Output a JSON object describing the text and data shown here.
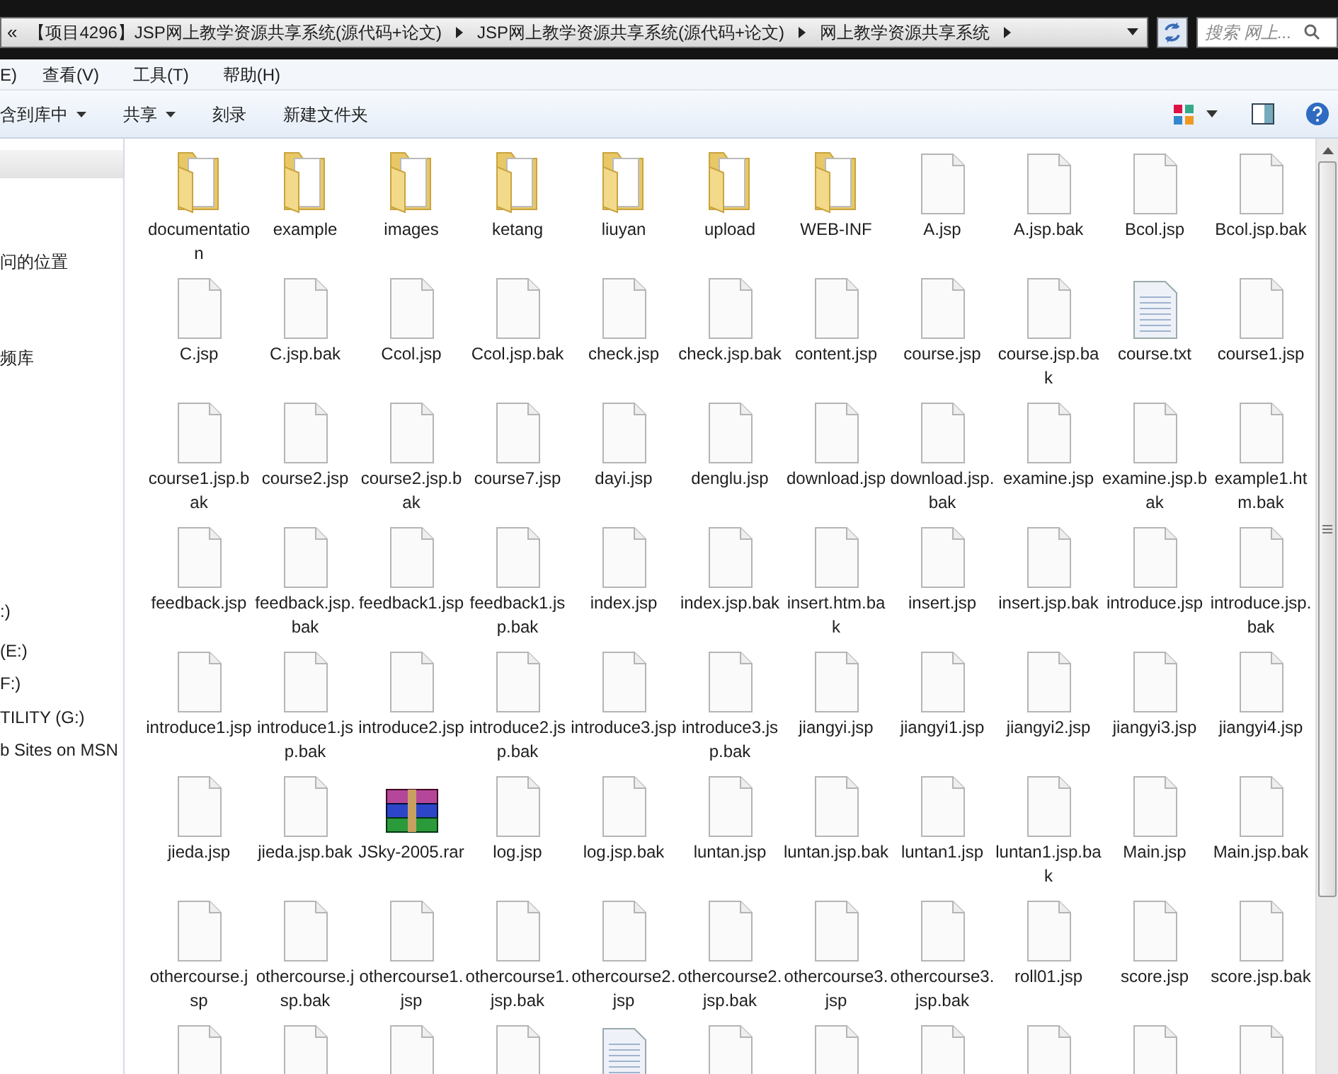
{
  "address_bar": {
    "overflow": "«",
    "crumbs": [
      "【项目4296】JSP网上教学资源共享系统(源代码+论文)",
      "JSP网上教学资源共享系统(源代码+论文)",
      "网上教学资源共享系统"
    ]
  },
  "search": {
    "placeholder": "搜索 网上..."
  },
  "menu": [
    "E)",
    "查看(V)",
    "工具(T)",
    "帮助(H)"
  ],
  "toolbar": [
    {
      "label": "含到库中",
      "dropdown": true
    },
    {
      "label": "共享",
      "dropdown": true
    },
    {
      "label": "刻录",
      "dropdown": false
    },
    {
      "label": "新建文件夹",
      "dropdown": false
    }
  ],
  "sidebar": {
    "items": [
      "问的位置",
      "频库",
      ":)",
      "(E:)",
      "F:)",
      "TILITY (G:)",
      "b Sites on MSN"
    ]
  },
  "files": [
    {
      "name": "documentation",
      "kind": "folder"
    },
    {
      "name": "example",
      "kind": "folder"
    },
    {
      "name": "images",
      "kind": "folder"
    },
    {
      "name": "ketang",
      "kind": "folder"
    },
    {
      "name": "liuyan",
      "kind": "folder"
    },
    {
      "name": "upload",
      "kind": "folder"
    },
    {
      "name": "WEB-INF",
      "kind": "folder"
    },
    {
      "name": "A.jsp",
      "kind": "file"
    },
    {
      "name": "A.jsp.bak",
      "kind": "file"
    },
    {
      "name": "Bcol.jsp",
      "kind": "file"
    },
    {
      "name": "Bcol.jsp.bak",
      "kind": "file"
    },
    {
      "name": "C.jsp",
      "kind": "file"
    },
    {
      "name": "C.jsp.bak",
      "kind": "file"
    },
    {
      "name": "Ccol.jsp",
      "kind": "file"
    },
    {
      "name": "Ccol.jsp.bak",
      "kind": "file"
    },
    {
      "name": "check.jsp",
      "kind": "file"
    },
    {
      "name": "check.jsp.bak",
      "kind": "file"
    },
    {
      "name": "content.jsp",
      "kind": "file"
    },
    {
      "name": "course.jsp",
      "kind": "file"
    },
    {
      "name": "course.jsp.bak",
      "kind": "file"
    },
    {
      "name": "course.txt",
      "kind": "text"
    },
    {
      "name": "course1.jsp",
      "kind": "file"
    },
    {
      "name": "course1.jsp.bak",
      "kind": "file"
    },
    {
      "name": "course2.jsp",
      "kind": "file"
    },
    {
      "name": "course2.jsp.bak",
      "kind": "file"
    },
    {
      "name": "course7.jsp",
      "kind": "file"
    },
    {
      "name": "dayi.jsp",
      "kind": "file"
    },
    {
      "name": "denglu.jsp",
      "kind": "file"
    },
    {
      "name": "download.jsp",
      "kind": "file"
    },
    {
      "name": "download.jsp.bak",
      "kind": "file"
    },
    {
      "name": "examine.jsp",
      "kind": "file"
    },
    {
      "name": "examine.jsp.bak",
      "kind": "file"
    },
    {
      "name": "example1.htm.bak",
      "kind": "file"
    },
    {
      "name": "feedback.jsp",
      "kind": "file"
    },
    {
      "name": "feedback.jsp.bak",
      "kind": "file"
    },
    {
      "name": "feedback1.jsp",
      "kind": "file"
    },
    {
      "name": "feedback1.jsp.bak",
      "kind": "file"
    },
    {
      "name": "index.jsp",
      "kind": "file"
    },
    {
      "name": "index.jsp.bak",
      "kind": "file"
    },
    {
      "name": "insert.htm.bak",
      "kind": "file"
    },
    {
      "name": "insert.jsp",
      "kind": "file"
    },
    {
      "name": "insert.jsp.bak",
      "kind": "file"
    },
    {
      "name": "introduce.jsp",
      "kind": "file"
    },
    {
      "name": "introduce.jsp.bak",
      "kind": "file"
    },
    {
      "name": "introduce1.jsp",
      "kind": "file"
    },
    {
      "name": "introduce1.jsp.bak",
      "kind": "file"
    },
    {
      "name": "introduce2.jsp",
      "kind": "file"
    },
    {
      "name": "introduce2.jsp.bak",
      "kind": "file"
    },
    {
      "name": "introduce3.jsp",
      "kind": "file"
    },
    {
      "name": "introduce3.jsp.bak",
      "kind": "file"
    },
    {
      "name": "jiangyi.jsp",
      "kind": "file"
    },
    {
      "name": "jiangyi1.jsp",
      "kind": "file"
    },
    {
      "name": "jiangyi2.jsp",
      "kind": "file"
    },
    {
      "name": "jiangyi3.jsp",
      "kind": "file"
    },
    {
      "name": "jiangyi4.jsp",
      "kind": "file"
    },
    {
      "name": "jieda.jsp",
      "kind": "file"
    },
    {
      "name": "jieda.jsp.bak",
      "kind": "file"
    },
    {
      "name": "JSky-2005.rar",
      "kind": "archive"
    },
    {
      "name": "log.jsp",
      "kind": "file"
    },
    {
      "name": "log.jsp.bak",
      "kind": "file"
    },
    {
      "name": "luntan.jsp",
      "kind": "file"
    },
    {
      "name": "luntan.jsp.bak",
      "kind": "file"
    },
    {
      "name": "luntan1.jsp",
      "kind": "file"
    },
    {
      "name": "luntan1.jsp.bak",
      "kind": "file"
    },
    {
      "name": "Main.jsp",
      "kind": "file"
    },
    {
      "name": "Main.jsp.bak",
      "kind": "file"
    },
    {
      "name": "othercourse.jsp",
      "kind": "file"
    },
    {
      "name": "othercourse.jsp.bak",
      "kind": "file"
    },
    {
      "name": "othercourse1.jsp",
      "kind": "file"
    },
    {
      "name": "othercourse1.jsp.bak",
      "kind": "file"
    },
    {
      "name": "othercourse2.jsp",
      "kind": "file"
    },
    {
      "name": "othercourse2.jsp.bak",
      "kind": "file"
    },
    {
      "name": "othercourse3.jsp",
      "kind": "file"
    },
    {
      "name": "othercourse3.jsp.bak",
      "kind": "file"
    },
    {
      "name": "roll01.jsp",
      "kind": "file"
    },
    {
      "name": "score.jsp",
      "kind": "file"
    },
    {
      "name": "score.jsp.bak",
      "kind": "file"
    },
    {
      "kind": "file"
    },
    {
      "kind": "file"
    },
    {
      "kind": "file"
    },
    {
      "kind": "file"
    },
    {
      "kind": "text"
    },
    {
      "kind": "file"
    },
    {
      "kind": "file"
    },
    {
      "kind": "file"
    },
    {
      "kind": "file"
    },
    {
      "kind": "file"
    },
    {
      "kind": "file"
    }
  ]
}
